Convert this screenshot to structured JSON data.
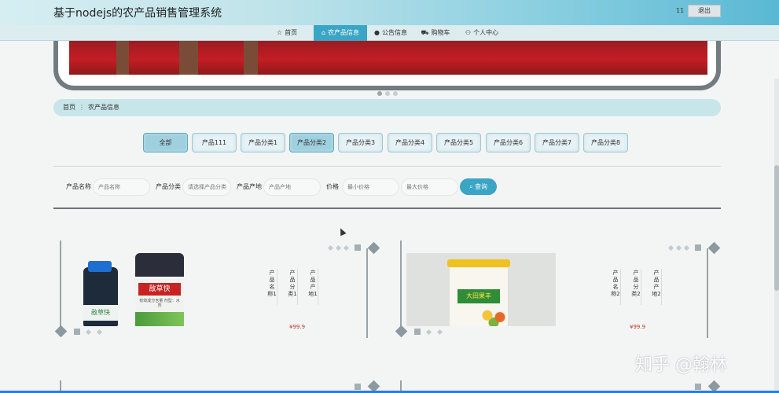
{
  "header": {
    "title": "基于nodejs的农产品销售管理系统",
    "user": "11",
    "logout": "退出"
  },
  "nav": [
    {
      "label": "首页",
      "icon": "star-icon"
    },
    {
      "label": "农产品信息",
      "icon": "home-icon",
      "active": true
    },
    {
      "label": "公告信息",
      "icon": "info-icon"
    },
    {
      "label": "购物车",
      "icon": "cart-icon"
    },
    {
      "label": "个人中心",
      "icon": "user-icon"
    }
  ],
  "breadcrumb": {
    "home": "首页",
    "sep": "⋮",
    "current": "农产品信息"
  },
  "categories": [
    "全部",
    "产品111",
    "产品分类1",
    "产品分类2",
    "产品分类3",
    "产品分类4",
    "产品分类5",
    "产品分类6",
    "产品分类7",
    "产品分类8"
  ],
  "search": {
    "name_label": "产品名称",
    "name_placeholder": "产品名称",
    "cat_label": "产品分类",
    "cat_placeholder": "请选择产品分类",
    "origin_label": "产品产地",
    "origin_placeholder": "产品产地",
    "price_label": "价格",
    "min_placeholder": "最小价格",
    "max_placeholder": "最大价格",
    "button": "查询"
  },
  "products": [
    {
      "name": "产品名称1",
      "category": "产品分类1",
      "origin": "产品产地1",
      "price": "¥99.9",
      "image_text_big": "敌草快",
      "image_text_small": "敌草快",
      "image_subtext": "有效成分含量 剂型：水剂"
    },
    {
      "name": "产品名称2",
      "category": "产品分类2",
      "origin": "产品产地2",
      "price": "¥99.9",
      "image_text_big": "大田果丰"
    }
  ],
  "watermark": "知乎 @翰林"
}
